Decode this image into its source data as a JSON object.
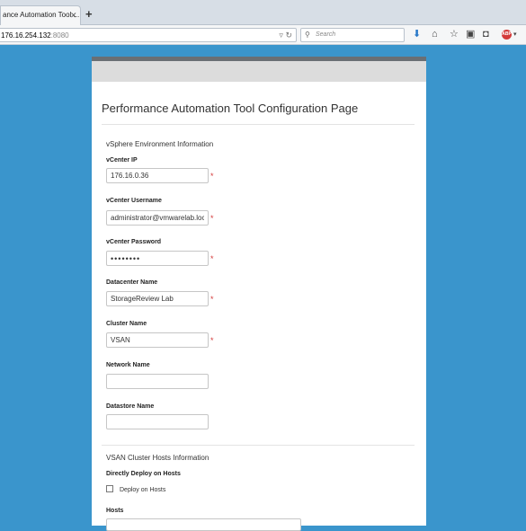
{
  "browser": {
    "tab_title": "ance Automation Tool ...",
    "url_host": "176.16.254.132",
    "url_port": ":8080",
    "search_placeholder": "Search"
  },
  "page": {
    "title": "Performance Automation Tool Configuration Page",
    "section_vsphere": "vSphere Environment Information",
    "vcenter_ip": {
      "label": "vCenter IP",
      "value": "176.16.0.36"
    },
    "vcenter_username": {
      "label": "vCenter Username",
      "value": "administrator@vmwarelab.loc"
    },
    "vcenter_password": {
      "label": "vCenter Password",
      "value": "••••••••"
    },
    "datacenter_name": {
      "label": "Datacenter Name",
      "value": "StorageReview Lab"
    },
    "cluster_name": {
      "label": "Cluster Name",
      "value": "VSAN"
    },
    "network_name": {
      "label": "Network Name",
      "value": ""
    },
    "datastore_name": {
      "label": "Datastore Name",
      "value": ""
    },
    "required_mark": "*",
    "section_vsan": "VSAN Cluster Hosts Information",
    "direct_deploy": {
      "label": "Directly Deploy on Hosts",
      "checkbox_label": "Deploy on Hosts",
      "checked": false
    },
    "hosts": {
      "label": "Hosts",
      "value": ""
    }
  },
  "colors": {
    "background": "#3a95cc",
    "required": "#d43a3a",
    "panel_top": "#6a6f74"
  }
}
